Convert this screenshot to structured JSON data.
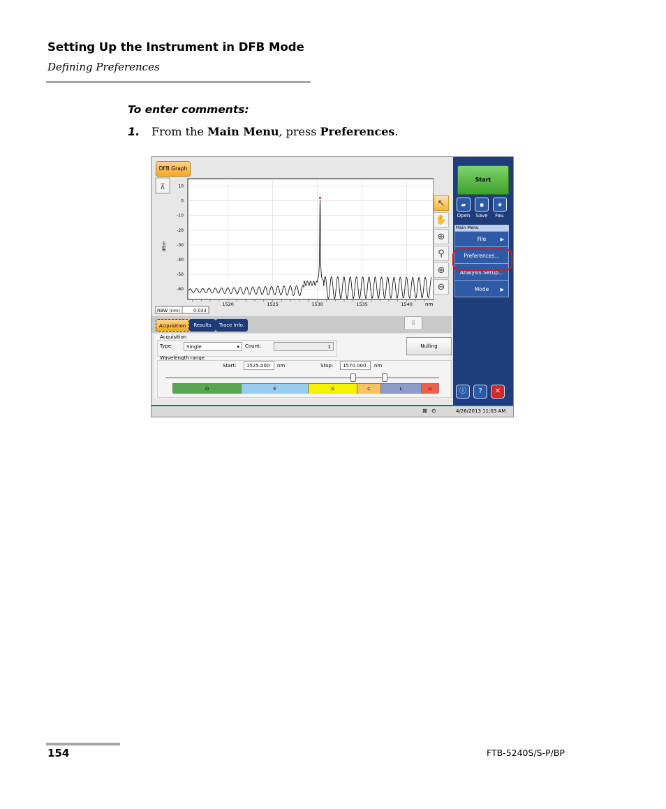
{
  "header": {
    "title": "Setting Up the Instrument in DFB Mode",
    "subtitle": "Defining Preferences"
  },
  "procedure": {
    "title": "To enter comments:",
    "step_number": "1.",
    "step_prefix": "From the ",
    "step_bold1": "Main Menu",
    "step_mid": ", press ",
    "step_bold2": "Preferences",
    "step_suffix": "."
  },
  "footer": {
    "page_number": "154",
    "model": "FTB-5240S/S-P/BP"
  },
  "app": {
    "graph_tab": "DFB Graph",
    "rbw_label": "RBW (nm)",
    "rbw_value": "0.033",
    "tabs": [
      "Acquisition",
      "Results",
      "Trace Info."
    ],
    "acquisition": {
      "section": "Acquisition",
      "type_label": "Type:",
      "type_value": "Single",
      "count_label": "Count:",
      "count_value": "1",
      "nulling": "Nulling"
    },
    "wavelength": {
      "section": "Wavelength range",
      "start_label": "Start:",
      "start_value": "1525.000",
      "stop_label": "Stop:",
      "stop_value": "1570.000",
      "unit": "nm"
    },
    "bands": [
      {
        "label": "O",
        "color": "#5aa550"
      },
      {
        "label": "E",
        "color": "#99cdf0"
      },
      {
        "label": "S",
        "color": "#f5f200"
      },
      {
        "label": "C",
        "color": "#f7c266"
      },
      {
        "label": "L",
        "color": "#8a9cc7"
      },
      {
        "label": "U",
        "color": "#f0604b"
      }
    ],
    "sidebar": {
      "start": "Start",
      "open": "Open",
      "save": "Save",
      "fav": "Fav.",
      "menu_header": "Main Menu",
      "items": [
        "File",
        "Preferences...",
        "Analysis Setup...",
        "Mode"
      ]
    },
    "status": {
      "datetime": "4/26/2013 11:03 AM"
    }
  },
  "chart_data": {
    "type": "line",
    "title": "",
    "xlabel": "nm",
    "ylabel": "dBm",
    "xlim": [
      1515.5,
      1543.0
    ],
    "ylim": [
      -67,
      15
    ],
    "x_ticks": [
      1520,
      1525,
      1530,
      1535,
      1540
    ],
    "y_ticks": [
      10,
      0,
      -10,
      -20,
      -30,
      -40,
      -50,
      -60
    ],
    "grid": true,
    "peak": {
      "x": 1530.3,
      "y": 2
    },
    "noise_floor": -60,
    "ripple_period_nm": 0.7
  }
}
